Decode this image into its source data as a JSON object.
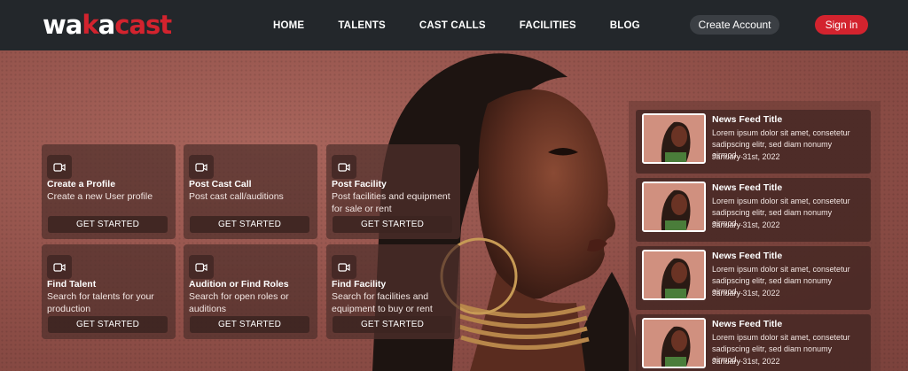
{
  "brand": {
    "logo_part1": "wa",
    "logo_accent1": "k",
    "logo_part2": "a",
    "logo_accent2": "cast"
  },
  "nav": {
    "links": [
      "HOME",
      "TALENTS",
      "CAST CALLS",
      "FACILITIES",
      "BLOG"
    ],
    "create_account": "Create Account",
    "sign_in": "Sign in"
  },
  "cards": [
    {
      "title": "Create a Profile",
      "desc": "Create a new User profile",
      "button": "GET STARTED",
      "icon": "video-icon"
    },
    {
      "title": "Post Cast Call",
      "desc": "Post cast call/auditions",
      "button": "GET STARTED",
      "icon": "video-icon"
    },
    {
      "title": "Post Facility",
      "desc": "Post facilities and equipment for sale or rent",
      "button": "GET STARTED",
      "icon": "video-icon"
    },
    {
      "title": "Find Talent",
      "desc": "Search for talents for your production",
      "button": "GET STARTED",
      "icon": "video-icon"
    },
    {
      "title": "Audition or Find Roles",
      "desc": "Search for open roles or auditions",
      "button": "GET STARTED",
      "icon": "video-icon"
    },
    {
      "title": "Find Facility",
      "desc": "Search for facilities and equipment to buy or rent",
      "button": "GET STARTED",
      "icon": "video-icon"
    }
  ],
  "news": [
    {
      "title": "News Feed Title",
      "body": "Lorem ipsum dolor sit amet, consetetur sadipscing elitr, sed diam nonumy eirmod...",
      "date": "January 31st, 2022"
    },
    {
      "title": "News Feed Title",
      "body": "Lorem ipsum dolor sit amet, consetetur sadipscing elitr, sed diam nonumy eirmod...",
      "date": "January 31st, 2022"
    },
    {
      "title": "News Feed Title",
      "body": "Lorem ipsum dolor sit amet, consetetur sadipscing elitr, sed diam nonumy eirmod...",
      "date": "January 31st, 2022"
    },
    {
      "title": "News Feed Title",
      "body": "Lorem ipsum dolor sit amet, consetetur sadipscing elitr, sed diam nonumy eirmod...",
      "date": "January 31st, 2022"
    }
  ],
  "colors": {
    "accent": "#d3232e",
    "navbar": "#23272b",
    "hero": "#8f4f48"
  }
}
